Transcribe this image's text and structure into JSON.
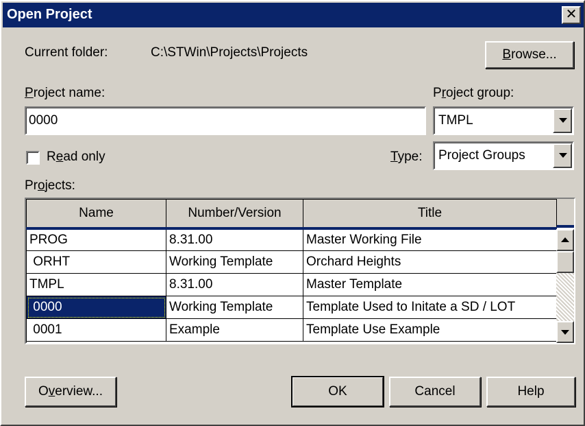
{
  "window": {
    "title": "Open Project",
    "close_glyph": "✕"
  },
  "current_folder": {
    "label": "Current folder:",
    "value": "C:\\STWin\\Projects\\Projects"
  },
  "browse_button": {
    "pre": "",
    "accel": "B",
    "post": "rowse..."
  },
  "project_name": {
    "pre": "",
    "accel": "P",
    "post": "roject name:",
    "value": "0000"
  },
  "project_group": {
    "pre": "P",
    "accel": "r",
    "post": "oject group:",
    "value": "TMPL"
  },
  "read_only": {
    "pre": "R",
    "accel": "e",
    "post": "ad only",
    "checked": false
  },
  "type": {
    "pre": "",
    "accel": "T",
    "post": "ype:",
    "value": "Project Groups"
  },
  "projects_label": {
    "pre": "Pr",
    "accel": "o",
    "post": "jects:"
  },
  "table": {
    "columns": [
      "Name",
      "Number/Version",
      "Title"
    ],
    "rows": [
      {
        "name": "PROG",
        "number": "8.31.00",
        "title": "Master Working File"
      },
      {
        "name": " ORHT",
        "number": "Working Template",
        "title": "Orchard Heights"
      },
      {
        "name": "TMPL",
        "number": "8.31.00",
        "title": "Master Template"
      },
      {
        "name": " 0000",
        "number": "Working Template",
        "title": "Template Used to Initate a SD / LOT"
      },
      {
        "name": " 0001",
        "number": "Example",
        "title": "Template Use Example"
      }
    ]
  },
  "buttons": {
    "overview": {
      "pre": "O",
      "accel": "v",
      "post": "erview..."
    },
    "ok": "OK",
    "cancel": "Cancel",
    "help": "Help"
  },
  "colors": {
    "titlebar": "#0a246a",
    "face": "#d4d0c8",
    "selection": "#0a246a"
  },
  "icons": {
    "close": "close-icon",
    "dropdown": "chevron-down-icon",
    "scroll_up": "scroll-up-arrow",
    "scroll_down": "scroll-down-arrow"
  }
}
